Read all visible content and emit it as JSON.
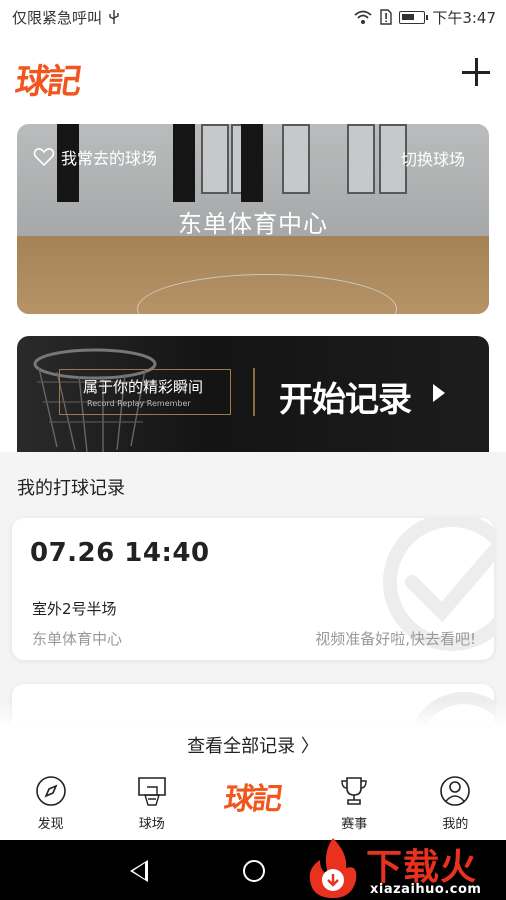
{
  "status_bar": {
    "left_text": "仅限紧急呼叫",
    "time": "下午3:47"
  },
  "header": {
    "logo": "球記"
  },
  "court_card": {
    "favorite_label": "我常去的球场",
    "switch_label": "切换球场",
    "court_name": "东单体育中心"
  },
  "record_banner": {
    "slogan": "属于你的精彩瞬间",
    "slogan_sub": "Record Replay Remember",
    "start_label": "开始记录"
  },
  "records": {
    "section_title": "我的打球记录",
    "items": [
      {
        "time": "07.26  14:40",
        "venue": "室外2号半场",
        "center": "东单体育中心",
        "status": "视频准备好啦,快去看吧!"
      }
    ],
    "view_all": "查看全部记录 〉"
  },
  "tab_bar": {
    "tabs": [
      {
        "label": "发现",
        "icon": "compass-icon"
      },
      {
        "label": "球场",
        "icon": "hoop-icon"
      },
      {
        "label": "球記",
        "icon": "logo"
      },
      {
        "label": "赛事",
        "icon": "trophy-icon"
      },
      {
        "label": "我的",
        "icon": "profile-icon"
      }
    ]
  },
  "watermark": {
    "text": "下载火",
    "sub": "xiazaihuo.com"
  },
  "colors": {
    "brand": "#f0561d",
    "banner_gold": "#9a7b4a",
    "watermark_red": "#e8321f"
  }
}
